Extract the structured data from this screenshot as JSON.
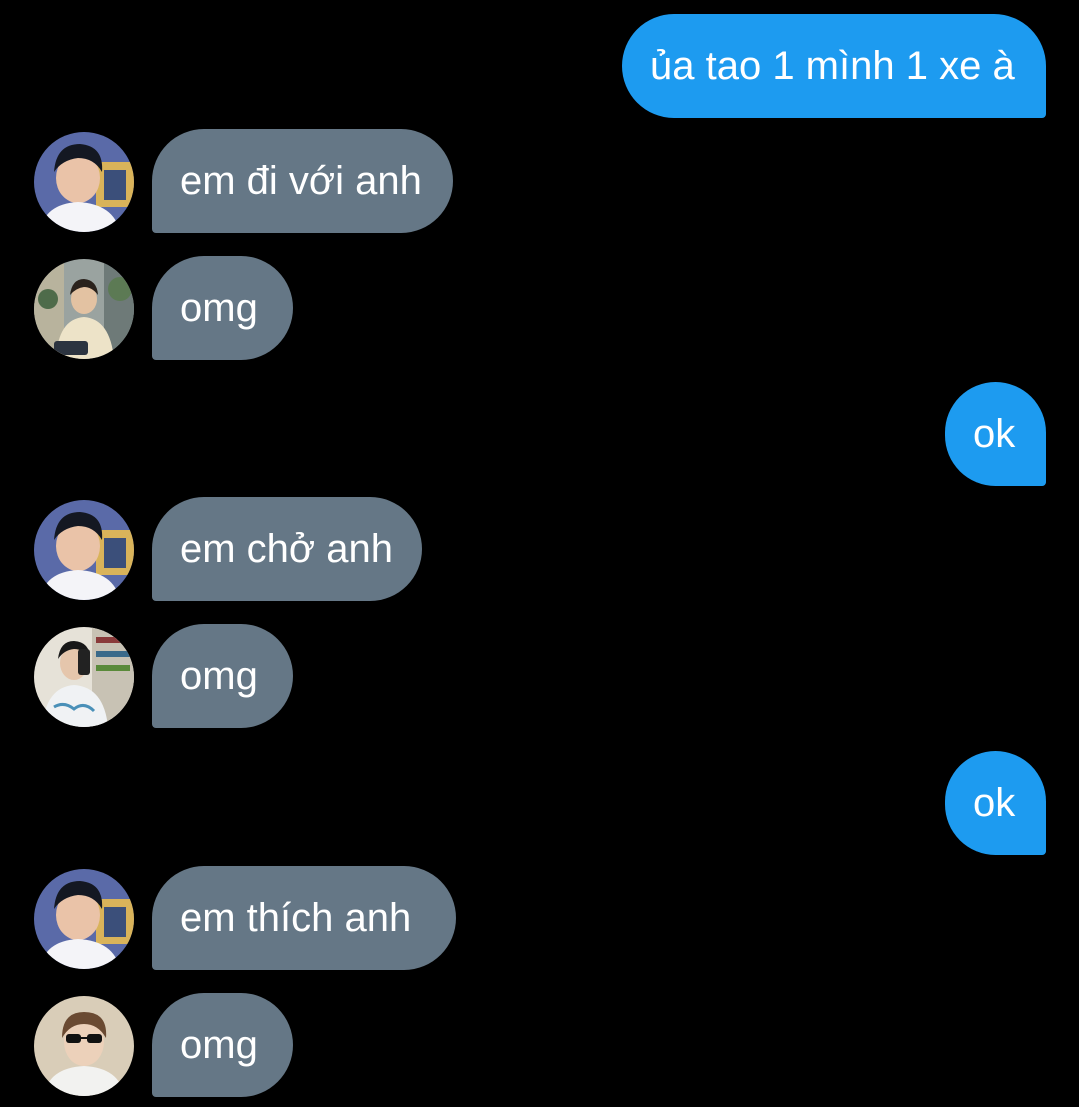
{
  "messages": [
    {
      "side": "out",
      "text": "ủa tao 1 mình 1 xe à"
    },
    {
      "side": "in",
      "text": "em đi với anh",
      "avatar": "avatar-user-a"
    },
    {
      "side": "in",
      "text": "omg",
      "avatar": "avatar-user-b"
    },
    {
      "side": "out",
      "text": "ok"
    },
    {
      "side": "in",
      "text": "em chở anh",
      "avatar": "avatar-user-a"
    },
    {
      "side": "in",
      "text": "omg",
      "avatar": "avatar-user-c"
    },
    {
      "side": "out",
      "text": "ok"
    },
    {
      "side": "in",
      "text": "em thích anh",
      "avatar": "avatar-user-a"
    },
    {
      "side": "in",
      "text": "omg",
      "avatar": "avatar-user-d"
    }
  ],
  "colors": {
    "background": "#000000",
    "outgoing_bubble": "#1d9bf0",
    "incoming_bubble": "#657786",
    "text": "#ffffff"
  }
}
